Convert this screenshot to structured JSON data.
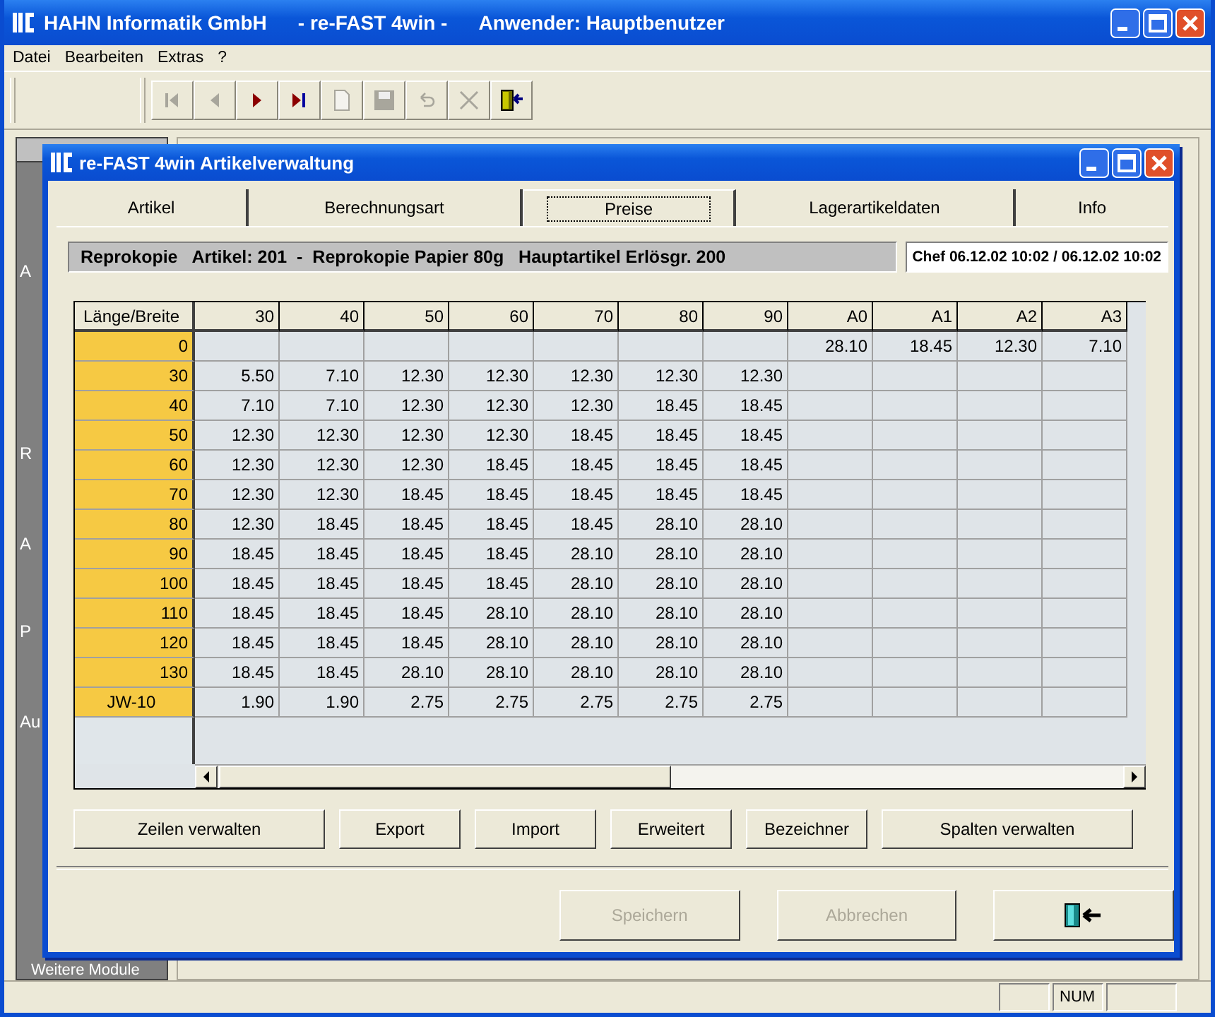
{
  "main_window": {
    "title_parts": [
      "HAHN Informatik GmbH",
      "- re-FAST 4win -",
      "Anwender: Hauptbenutzer"
    ]
  },
  "menu": [
    "Datei",
    "Bearbeiten",
    "Extras",
    "?"
  ],
  "toolbar": [
    {
      "kind": "first",
      "disabled": true
    },
    {
      "kind": "prev",
      "disabled": true
    },
    {
      "kind": "next",
      "disabled": false
    },
    {
      "kind": "last",
      "disabled": false
    },
    {
      "kind": "new",
      "disabled": true
    },
    {
      "kind": "save",
      "disabled": true
    },
    {
      "kind": "undo",
      "disabled": true
    },
    {
      "kind": "delete",
      "disabled": true
    },
    {
      "kind": "exit",
      "disabled": false
    }
  ],
  "sidebar": {
    "items": [
      "A",
      "R",
      "A",
      "P",
      "Au"
    ],
    "footer": "Weitere Module"
  },
  "dialog": {
    "title": "re-FAST 4win Artikelverwaltung",
    "tabs": [
      {
        "label": "Artikel",
        "selected": false
      },
      {
        "label": "Berechnungsart",
        "selected": false
      },
      {
        "label": "Preise",
        "selected": true
      },
      {
        "label": "Lagerartikeldaten",
        "selected": false
      },
      {
        "label": "Info",
        "selected": false
      }
    ],
    "info": "Reprokopie   Artikel: 201  -  Reprokopie Papier 80g   Hauptartikel Erlösgr. 200",
    "stamp": "Chef 06.12.02 10:02 / 06.12.02 10:02",
    "table": {
      "columns": [
        "Länge/Breite",
        "30",
        "40",
        "50",
        "60",
        "70",
        "80",
        "90",
        "A0",
        "A1",
        "A2",
        "A3"
      ],
      "rows": [
        [
          "0",
          "",
          "",
          "",
          "",
          "",
          "",
          "",
          "28.10",
          "18.45",
          "12.30",
          "7.10"
        ],
        [
          "30",
          "5.50",
          "7.10",
          "12.30",
          "12.30",
          "12.30",
          "12.30",
          "12.30",
          "",
          "",
          "",
          ""
        ],
        [
          "40",
          "7.10",
          "7.10",
          "12.30",
          "12.30",
          "12.30",
          "18.45",
          "18.45",
          "",
          "",
          "",
          ""
        ],
        [
          "50",
          "12.30",
          "12.30",
          "12.30",
          "12.30",
          "18.45",
          "18.45",
          "18.45",
          "",
          "",
          "",
          ""
        ],
        [
          "60",
          "12.30",
          "12.30",
          "12.30",
          "18.45",
          "18.45",
          "18.45",
          "18.45",
          "",
          "",
          "",
          ""
        ],
        [
          "70",
          "12.30",
          "12.30",
          "18.45",
          "18.45",
          "18.45",
          "18.45",
          "18.45",
          "",
          "",
          "",
          ""
        ],
        [
          "80",
          "12.30",
          "18.45",
          "18.45",
          "18.45",
          "18.45",
          "28.10",
          "28.10",
          "",
          "",
          "",
          ""
        ],
        [
          "90",
          "18.45",
          "18.45",
          "18.45",
          "18.45",
          "28.10",
          "28.10",
          "28.10",
          "",
          "",
          "",
          ""
        ],
        [
          "100",
          "18.45",
          "18.45",
          "18.45",
          "18.45",
          "28.10",
          "28.10",
          "28.10",
          "",
          "",
          "",
          ""
        ],
        [
          "110",
          "18.45",
          "18.45",
          "18.45",
          "28.10",
          "28.10",
          "28.10",
          "28.10",
          "",
          "",
          "",
          ""
        ],
        [
          "120",
          "18.45",
          "18.45",
          "18.45",
          "28.10",
          "28.10",
          "28.10",
          "28.10",
          "",
          "",
          "",
          ""
        ],
        [
          "130",
          "18.45",
          "18.45",
          "28.10",
          "28.10",
          "28.10",
          "28.10",
          "28.10",
          "",
          "",
          "",
          ""
        ],
        [
          "JW-10",
          "1.90",
          "1.90",
          "2.75",
          "2.75",
          "2.75",
          "2.75",
          "2.75",
          "",
          "",
          "",
          ""
        ]
      ]
    },
    "actions": [
      "Zeilen verwalten",
      "Export",
      "Import",
      "Erweitert",
      "Bezeichner",
      "Spalten verwalten"
    ],
    "footer_buttons": [
      {
        "kind": "text",
        "label": "Speichern",
        "disabled": true
      },
      {
        "kind": "text",
        "label": "Abbrechen",
        "disabled": true
      },
      {
        "kind": "exit",
        "disabled": false
      }
    ]
  },
  "status_bar": {
    "panels": [
      "NUM"
    ]
  }
}
